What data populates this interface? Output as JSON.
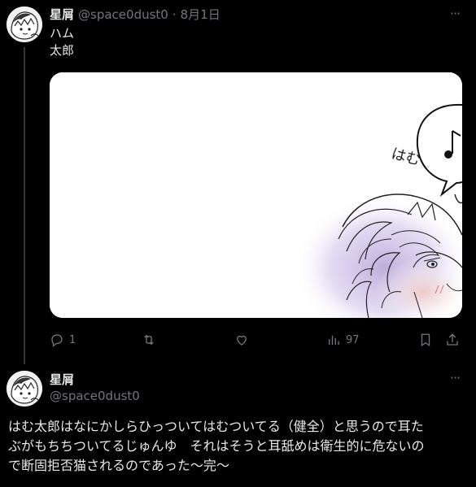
{
  "tweet1": {
    "name": "星屑",
    "handle": "@space0dust0",
    "separator": "·",
    "date": "8月1日",
    "text_lines": [
      "ハム",
      "太郎"
    ],
    "media": {
      "doodle_text": "はむ"
    },
    "actions": {
      "reply_count": "1",
      "retweet_count": "",
      "like_count": "",
      "views_count": "97"
    }
  },
  "tweet2": {
    "name": "星屑",
    "handle": "@space0dust0",
    "text_lines": [
      "はむ太郎はなにかしらひっついてはむついてる（健全）と思うので耳た",
      "ぶがもちちついてるじゅんゆ　それはそうと耳舐めは衛生的に危ないの",
      "で断固拒否猫されるのであった〜完〜"
    ]
  },
  "more_icon_text": "···"
}
